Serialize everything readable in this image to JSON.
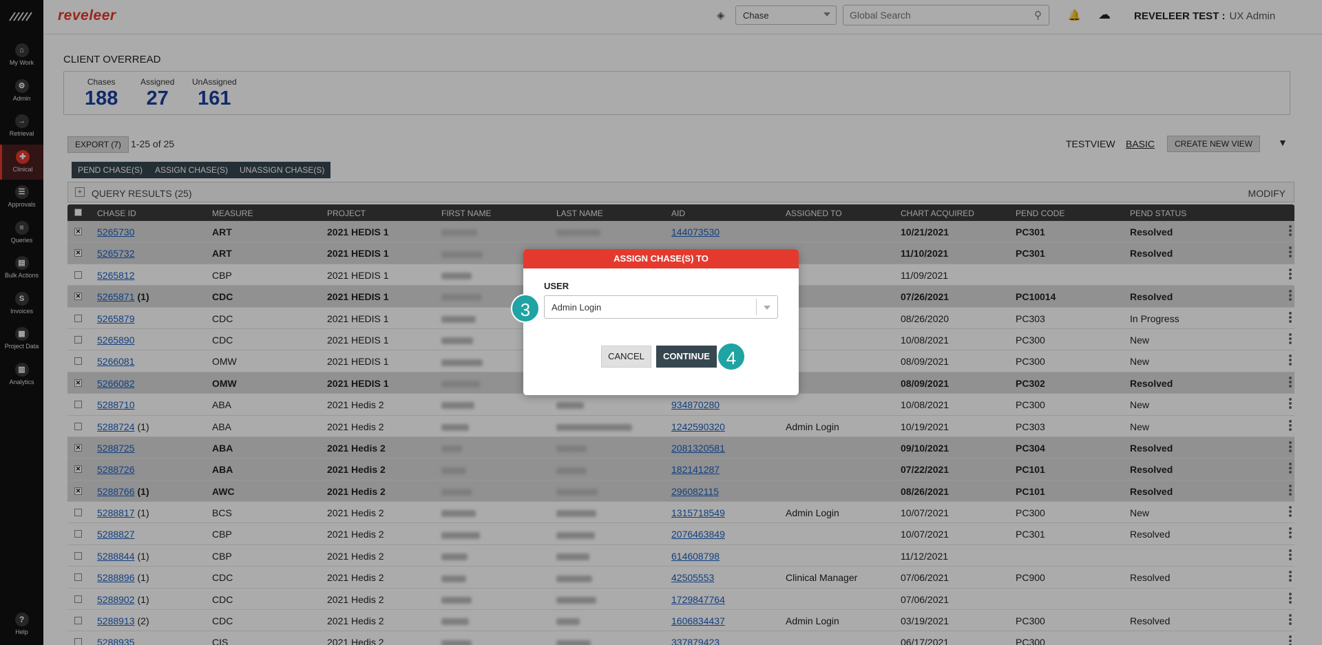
{
  "brand": "reveleer",
  "sidebar": {
    "items": [
      {
        "label": "My Work",
        "icon": "home-icon"
      },
      {
        "label": "Admin",
        "icon": "settings-icon"
      },
      {
        "label": "Retrieval",
        "icon": "retrieval-icon"
      },
      {
        "label": "Clinical",
        "icon": "clinical-icon"
      },
      {
        "label": "Approvals",
        "icon": "approvals-icon"
      },
      {
        "label": "Queries",
        "icon": "queries-icon"
      },
      {
        "label": "Bulk Actions",
        "icon": "bulk-actions-icon"
      },
      {
        "label": "Invoices",
        "icon": "invoices-icon"
      },
      {
        "label": "Project Data",
        "icon": "project-data-icon"
      },
      {
        "label": "Analytics",
        "icon": "analytics-icon"
      }
    ],
    "help": "Help",
    "active_color": "#e43a2e"
  },
  "header": {
    "chase_select": "Chase",
    "search_placeholder": "Global Search",
    "user": "REVELEER TEST :",
    "role": "UX Admin"
  },
  "page": {
    "title": "CLIENT OVERREAD",
    "stats": [
      {
        "label": "Chases",
        "value": "188"
      },
      {
        "label": "Assigned",
        "value": "27"
      },
      {
        "label": "UnAssigned",
        "value": "161"
      }
    ],
    "export": "EXPORT (7)",
    "pager": "1-25  of  25",
    "view": "TESTVIEW",
    "basic": "BASIC",
    "new_view": "CREATE NEW VIEW",
    "actions": [
      "PEND CHASE(S)",
      "ASSIGN CHASE(S)",
      "UNASSIGN CHASE(S)"
    ],
    "query_title": "QUERY RESULTS (25)",
    "modify": "MODIFY"
  },
  "table": {
    "columns": [
      "CHASE ID",
      "MEASURE",
      "PROJECT",
      "FIRST NAME",
      "LAST NAME",
      "AID",
      "ASSIGNED TO",
      "CHART ACQUIRED",
      "PEND CODE",
      "PEND STATUS"
    ],
    "rows": [
      {
        "sel": true,
        "id": "5265730",
        "suffix": "",
        "measure": "ART",
        "project": "2021 HEDIS 1",
        "aid": "144073530",
        "assigned": "",
        "chart": "10/21/2021",
        "pend": "PC301",
        "status": "Resolved"
      },
      {
        "sel": true,
        "id": "5265732",
        "suffix": "",
        "measure": "ART",
        "project": "2021 HEDIS 1",
        "aid": "",
        "assigned": "",
        "chart": "11/10/2021",
        "pend": "PC301",
        "status": "Resolved"
      },
      {
        "sel": false,
        "id": "5265812",
        "suffix": "",
        "measure": "CBP",
        "project": "2021 HEDIS 1",
        "aid": "",
        "assigned": "",
        "chart": "11/09/2021",
        "pend": "",
        "status": ""
      },
      {
        "sel": true,
        "id": "5265871",
        "suffix": "(1)",
        "measure": "CDC",
        "project": "2021 HEDIS 1",
        "aid": "",
        "assigned": "",
        "chart": "07/26/2021",
        "pend": "PC10014",
        "status": "Resolved"
      },
      {
        "sel": false,
        "id": "5265879",
        "suffix": "",
        "measure": "CDC",
        "project": "2021 HEDIS 1",
        "aid": "",
        "assigned": "",
        "chart": "08/26/2020",
        "pend": "PC303",
        "status": "In Progress"
      },
      {
        "sel": false,
        "id": "5265890",
        "suffix": "",
        "measure": "CDC",
        "project": "2021 HEDIS 1",
        "aid": "",
        "assigned": "",
        "chart": "10/08/2021",
        "pend": "PC300",
        "status": "New"
      },
      {
        "sel": false,
        "id": "5266081",
        "suffix": "",
        "measure": "OMW",
        "project": "2021 HEDIS 1",
        "aid": "",
        "assigned": "",
        "chart": "08/09/2021",
        "pend": "PC300",
        "status": "New"
      },
      {
        "sel": true,
        "id": "5266082",
        "suffix": "",
        "measure": "OMW",
        "project": "2021 HEDIS 1",
        "aid": "",
        "assigned": "",
        "chart": "08/09/2021",
        "pend": "PC302",
        "status": "Resolved"
      },
      {
        "sel": false,
        "id": "5288710",
        "suffix": "",
        "measure": "ABA",
        "project": "2021 Hedis 2",
        "aid": "934870280",
        "assigned": "",
        "chart": "10/08/2021",
        "pend": "PC300",
        "status": "New"
      },
      {
        "sel": false,
        "id": "5288724",
        "suffix": "(1)",
        "measure": "ABA",
        "project": "2021 Hedis 2",
        "aid": "1242590320",
        "assigned": "Admin Login",
        "chart": "10/19/2021",
        "pend": "PC303",
        "status": "New"
      },
      {
        "sel": true,
        "id": "5288725",
        "suffix": "",
        "measure": "ABA",
        "project": "2021 Hedis 2",
        "aid": "2081320581",
        "assigned": "",
        "chart": "09/10/2021",
        "pend": "PC304",
        "status": "Resolved"
      },
      {
        "sel": true,
        "id": "5288726",
        "suffix": "",
        "measure": "ABA",
        "project": "2021 Hedis 2",
        "aid": "182141287",
        "assigned": "",
        "chart": "07/22/2021",
        "pend": "PC101",
        "status": "Resolved"
      },
      {
        "sel": true,
        "id": "5288766",
        "suffix": "(1)",
        "measure": "AWC",
        "project": "2021 Hedis 2",
        "aid": "296082115",
        "assigned": "",
        "chart": "08/26/2021",
        "pend": "PC101",
        "status": "Resolved"
      },
      {
        "sel": false,
        "id": "5288817",
        "suffix": "(1)",
        "measure": "BCS",
        "project": "2021 Hedis 2",
        "aid": "1315718549",
        "assigned": "Admin Login",
        "chart": "10/07/2021",
        "pend": "PC300",
        "status": "New"
      },
      {
        "sel": false,
        "id": "5288827",
        "suffix": "",
        "measure": "CBP",
        "project": "2021 Hedis 2",
        "aid": "2076463849",
        "assigned": "",
        "chart": "10/07/2021",
        "pend": "PC301",
        "status": "Resolved"
      },
      {
        "sel": false,
        "id": "5288844",
        "suffix": "(1)",
        "measure": "CBP",
        "project": "2021 Hedis 2",
        "aid": "614608798",
        "assigned": "",
        "chart": "11/12/2021",
        "pend": "",
        "status": ""
      },
      {
        "sel": false,
        "id": "5288896",
        "suffix": "(1)",
        "measure": "CDC",
        "project": "2021 Hedis 2",
        "aid": "42505553",
        "assigned": "Clinical Manager",
        "chart": "07/06/2021",
        "pend": "PC900",
        "status": "Resolved"
      },
      {
        "sel": false,
        "id": "5288902",
        "suffix": "(1)",
        "measure": "CDC",
        "project": "2021 Hedis 2",
        "aid": "1729847764",
        "assigned": "",
        "chart": "07/06/2021",
        "pend": "",
        "status": ""
      },
      {
        "sel": false,
        "id": "5288913",
        "suffix": "(2)",
        "measure": "CDC",
        "project": "2021 Hedis 2",
        "aid": "1606834437",
        "assigned": "Admin Login",
        "chart": "03/19/2021",
        "pend": "PC300",
        "status": "Resolved"
      },
      {
        "sel": false,
        "id": "5288935",
        "suffix": "",
        "measure": "CIS",
        "project": "2021 Hedis 2",
        "aid": "337879423",
        "assigned": "",
        "chart": "06/17/2021",
        "pend": "PC300",
        "status": ""
      }
    ]
  },
  "modal": {
    "title": "ASSIGN CHASE(S) TO",
    "user_label": "USER",
    "user_value": "Admin Login",
    "cancel": "CANCEL",
    "continue": "CONTINUE",
    "steps": [
      "3",
      "4"
    ],
    "header_color": "#e43a2e",
    "step_color": "#1fa3a3"
  }
}
